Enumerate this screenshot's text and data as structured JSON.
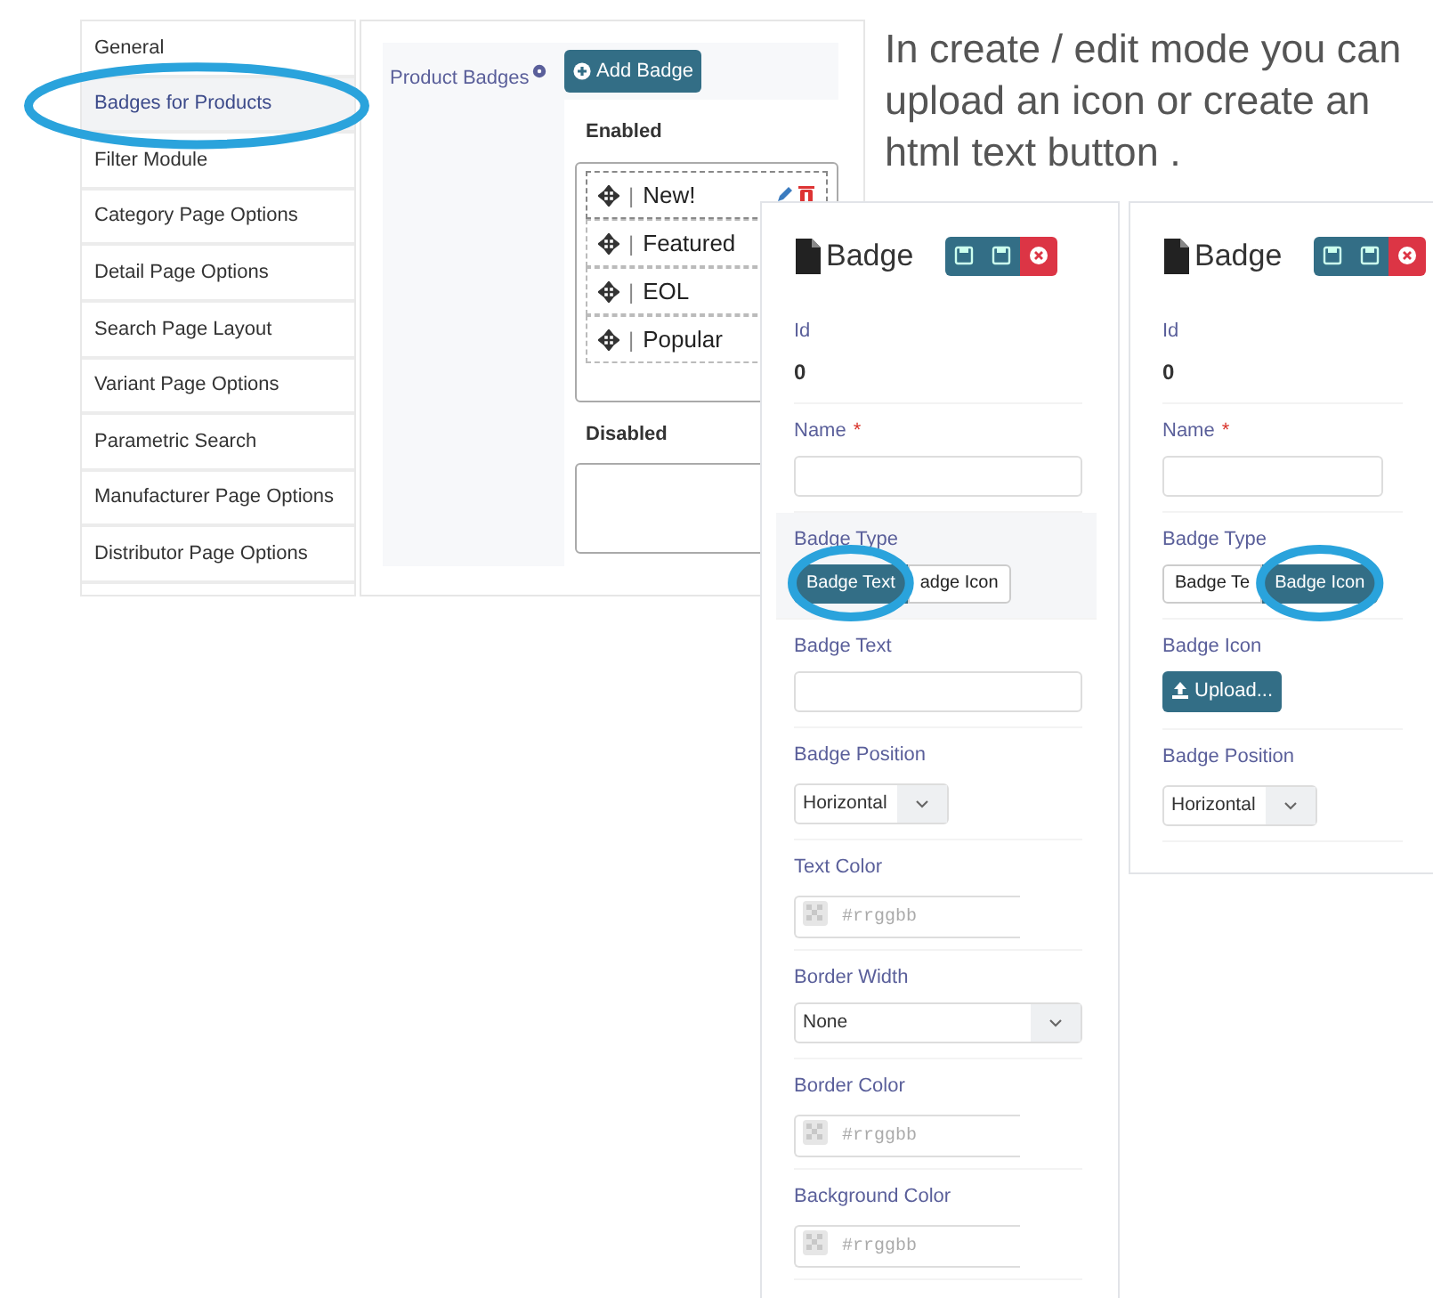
{
  "sidebar": {
    "items": [
      {
        "label": "General",
        "selected": false,
        "highlighted": false
      },
      {
        "label": "Badges for Products",
        "selected": true,
        "highlighted": true
      },
      {
        "label": "Filter Module",
        "selected": false,
        "highlighted": false
      },
      {
        "label": "Category Page Options",
        "selected": false,
        "highlighted": false
      },
      {
        "label": "Detail Page Options",
        "selected": false,
        "highlighted": false
      },
      {
        "label": "Search Page Layout",
        "selected": false,
        "highlighted": false
      },
      {
        "label": "Variant Page Options",
        "selected": false,
        "highlighted": false
      },
      {
        "label": "Parametric Search",
        "selected": false,
        "highlighted": false
      },
      {
        "label": "Manufacturer Page Options",
        "selected": false,
        "highlighted": false
      },
      {
        "label": "Distributor Page Options",
        "selected": false,
        "highlighted": false
      }
    ]
  },
  "badges": {
    "label": "Product Badges",
    "add_button": "Add Badge",
    "enabled": {
      "title": "Enabled",
      "items": [
        {
          "name": "New!",
          "separator": "|",
          "hovered": true
        },
        {
          "name": "Featured",
          "separator": "|",
          "hovered": false
        },
        {
          "name": "EOL",
          "separator": "|",
          "hovered": false
        },
        {
          "name": "Popular",
          "separator": "|",
          "hovered": false
        }
      ]
    },
    "disabled": {
      "title": "Disabled"
    }
  },
  "caption": "In create / edit mode you can upload an icon or create an html text button .",
  "badge_forms": [
    {
      "title": "Badge",
      "fields": [
        {
          "kind": "static",
          "label": "Id",
          "value": "0"
        },
        {
          "kind": "text",
          "label": "Name",
          "required_mark": "*"
        },
        {
          "kind": "segmented",
          "label": "Badge Type",
          "hovered": true,
          "options": [
            {
              "label": "Badge Text",
              "selected": true,
              "highlighted": true
            },
            {
              "label": "adge Icon",
              "selected": false,
              "highlighted": false
            }
          ]
        },
        {
          "kind": "text",
          "label": "Badge Text"
        },
        {
          "kind": "select-inline",
          "label": "Badge Position",
          "value": "Horizontal"
        },
        {
          "kind": "color",
          "label": "Text Color",
          "placeholder": "#rrggbb"
        },
        {
          "kind": "select",
          "label": "Border Width",
          "value": "None"
        },
        {
          "kind": "color",
          "label": "Border Color",
          "placeholder": "#rrggbb"
        },
        {
          "kind": "color",
          "label": "Background Color",
          "placeholder": "#rrggbb"
        }
      ]
    },
    {
      "title": "Badge",
      "fields": [
        {
          "kind": "static",
          "label": "Id",
          "value": "0"
        },
        {
          "kind": "text",
          "label": "Name",
          "required_mark": "*"
        },
        {
          "kind": "segmented",
          "label": "Badge Type",
          "hovered": false,
          "options": [
            {
              "label": "Badge Te",
              "selected": false,
              "highlighted": false
            },
            {
              "label": "Badge Icon",
              "selected": true,
              "highlighted": true
            }
          ]
        },
        {
          "kind": "upload",
          "label": "Badge Icon",
          "button": "Upload..."
        },
        {
          "kind": "select-inline",
          "label": "Badge Position",
          "value": "Horizontal"
        }
      ]
    }
  ]
}
